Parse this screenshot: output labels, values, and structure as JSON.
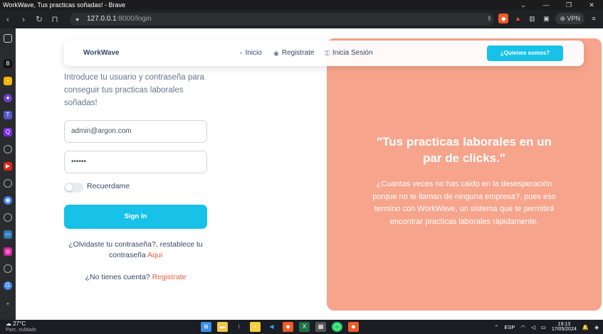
{
  "browser": {
    "window_title": "WorkWave, Tus practicas soñadas! - Brave",
    "url_host": "127.0.0.1",
    "url_path": ":8000/login",
    "vpn_label": "VPN",
    "controls": {
      "minimize": "⌄",
      "min": "—",
      "restore": "❐",
      "close": "✕"
    }
  },
  "navbar": {
    "brand": "WorkWave",
    "links": [
      {
        "label": "Inicio",
        "icon": "pie-chart-icon"
      },
      {
        "label": "Registrate",
        "icon": "user-circle-icon"
      },
      {
        "label": "Inicia Sesión",
        "icon": "key-icon"
      }
    ],
    "cta": "¿Quienes somos?"
  },
  "form": {
    "intro": "Introduce tu usuario y contraseña para conseguir tus practicas laborales soñadas!",
    "email_value": "admin@argon.com",
    "password_value": "••••••",
    "remember_label": "Recuerdame",
    "submit_label": "Sign In",
    "forgot_text": "¿Olvidaste tu contraseña?, restablece tu contraseña",
    "forgot_link": "Aqui",
    "signup_text": "¿No tienes cuenta?",
    "signup_link": "Registrate"
  },
  "hero": {
    "title": "\"Tus practicas laborales en un par de clicks.\"",
    "description": "¿Cuantas veces no has caido en la desesperación porque no te llaman de ninguna empresa?, pues eso termino con WorkWave, un sistema que te permitirá encontrar practicas laborales rápidamente.",
    "color": "#f7a48c"
  },
  "taskbar": {
    "temperature": "27°C",
    "weather": "Parc. nublado",
    "lang": "ESP",
    "time": "19:13",
    "date": "17/05/2024"
  }
}
